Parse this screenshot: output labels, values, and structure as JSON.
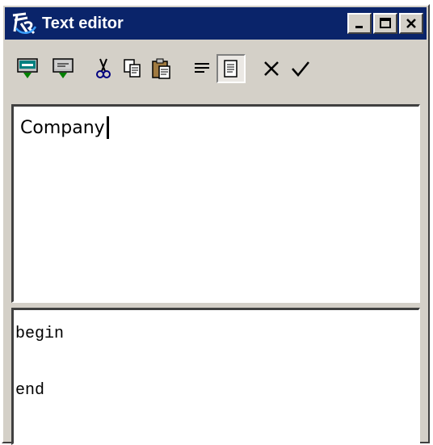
{
  "window": {
    "title": "Text editor"
  },
  "icons": {
    "app_logo": "app-logo-icon",
    "minimize": "minimize-icon",
    "maximize": "maximize-icon",
    "close": "close-icon",
    "tools": [
      "insert-field-icon",
      "insert-expression-icon",
      "cut-icon",
      "copy-icon",
      "paste-icon",
      "align-text-icon",
      "page-view-icon",
      "cancel-icon",
      "ok-icon"
    ]
  },
  "editor": {
    "text": "Company"
  },
  "script": {
    "line1": "begin",
    "line2": "",
    "line3": "end"
  },
  "colors": {
    "titlebar": "#0a246a",
    "face": "#d4d0c8"
  }
}
